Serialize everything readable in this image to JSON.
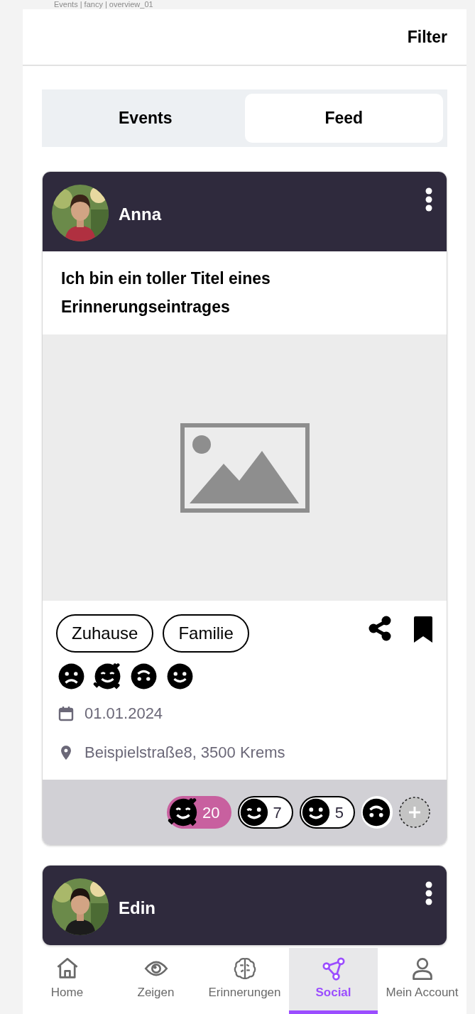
{
  "breadcrumb": "Events | fancy | overview_01",
  "header": {
    "filter": "Filter"
  },
  "tabs": [
    {
      "label": "Events",
      "selected": false
    },
    {
      "label": "Feed",
      "selected": true
    }
  ],
  "posts": [
    {
      "author": "Anna",
      "avatar": {
        "kind": "picture"
      },
      "title": "Ich bin ein toller Titel eines Erinnerungseintrages",
      "image": {
        "kind": "placeholder"
      },
      "tags": [
        "Zuhause",
        "Familie"
      ],
      "moods": [
        {
          "kind": "sad"
        },
        {
          "kind": "love"
        },
        {
          "kind": "upside"
        },
        {
          "kind": "smile"
        }
      ],
      "date": "01.01.2024",
      "location": "Beispielstraße8, 3500 Krems",
      "reactions": [
        {
          "kind": "love",
          "count": "20",
          "selected": true
        },
        {
          "kind": "wink",
          "count": "7",
          "selected": false
        },
        {
          "kind": "smile",
          "count": "5",
          "selected": false
        },
        {
          "kind": "upside",
          "selected": false
        }
      ]
    },
    {
      "author": "Edin",
      "avatar": {
        "kind": "picture"
      }
    }
  ],
  "nav": [
    {
      "label": "Home",
      "kind": "home",
      "selected": false
    },
    {
      "label": "Zeigen",
      "kind": "eye",
      "selected": false
    },
    {
      "label": "Erinnerungen",
      "kind": "brain",
      "selected": false
    },
    {
      "label": "Social",
      "kind": "social",
      "selected": true
    },
    {
      "label": "Mein Account",
      "kind": "user",
      "selected": false
    }
  ]
}
